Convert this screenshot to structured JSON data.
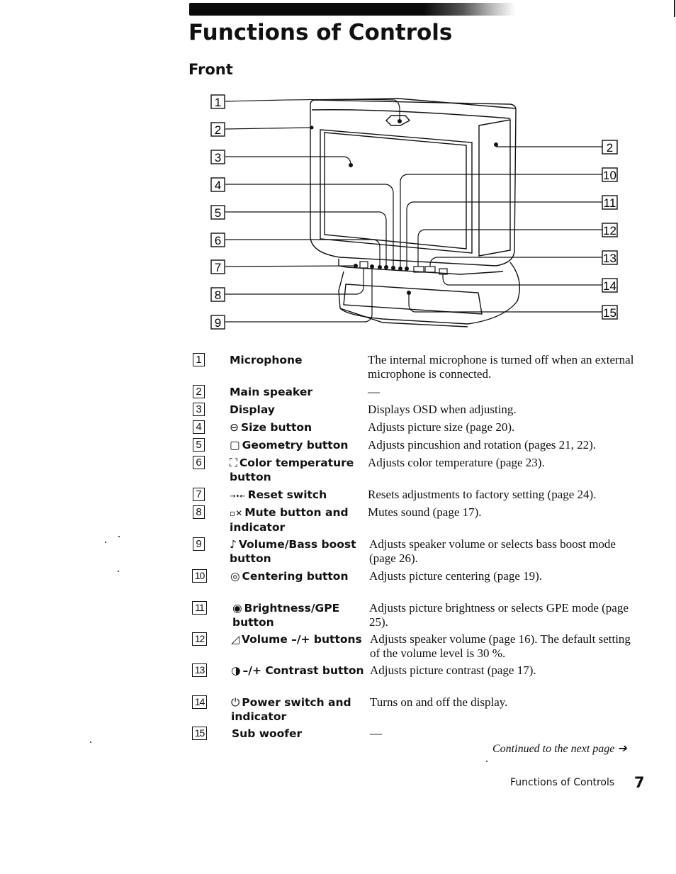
{
  "header": {
    "title": "Functions of Controls",
    "section": "Front"
  },
  "diagram": {
    "left_callouts": [
      "1",
      "2",
      "3",
      "4",
      "5",
      "6",
      "7",
      "8",
      "9"
    ],
    "right_callouts": [
      "2",
      "10",
      "11",
      "12",
      "13",
      "14",
      "15"
    ]
  },
  "items": [
    {
      "number": "1",
      "icon": "",
      "label": "Microphone",
      "description": "The internal microphone is turned off when an external microphone is connected."
    },
    {
      "number": "2",
      "icon": "",
      "label": "Main speaker",
      "description": "—"
    },
    {
      "number": "3",
      "icon": "",
      "label": "Display",
      "description": "Displays OSD when adjusting."
    },
    {
      "number": "4",
      "icon": "⊖",
      "label": "Size button",
      "description": "Adjusts picture size (page 20)."
    },
    {
      "number": "5",
      "icon": "▢",
      "label": "Geometry button",
      "description": "Adjusts pincushion and rotation (pages 21, 22)."
    },
    {
      "number": "6",
      "icon": "⛶",
      "label": "Color temperature button",
      "description": "Adjusts color temperature (page 23)."
    },
    {
      "number": "7",
      "icon": "→•←",
      "label": "Reset switch",
      "description": "Resets adjustments to factory setting (page 24)."
    },
    {
      "number": "8",
      "icon": "▫✕",
      "label": "Mute button and indicator",
      "description": "Mutes sound (page 17)."
    },
    {
      "number": "9",
      "icon": "♪",
      "label": "Volume/Bass boost button",
      "description": "Adjusts speaker volume or selects bass boost mode (page 26)."
    },
    {
      "number": "10",
      "icon": "◎",
      "label": "Centering button",
      "description": "Adjusts picture centering (page 19)."
    },
    {
      "number": "11",
      "icon": "◉",
      "label": "Brightness/GPE button",
      "description": "Adjusts picture brightness or selects GPE mode (page 25)."
    },
    {
      "number": "12",
      "icon": "◿",
      "label": "Volume –/+ buttons",
      "description": "Adjusts speaker volume (page 16). The default setting of the volume level is 30 %."
    },
    {
      "number": "13",
      "icon": "◑",
      "label": "–/+ Contrast button",
      "description": "Adjusts picture contrast (page 17)."
    },
    {
      "number": "14",
      "icon": "⏻",
      "label": "Power switch and indicator",
      "description": "Turns on and off the display."
    },
    {
      "number": "15",
      "icon": "",
      "label": "Sub woofer",
      "description": "—"
    }
  ],
  "footer": {
    "continued": "Continued to the next page ➔",
    "section_label": "Functions of Controls",
    "page_number": "7"
  }
}
